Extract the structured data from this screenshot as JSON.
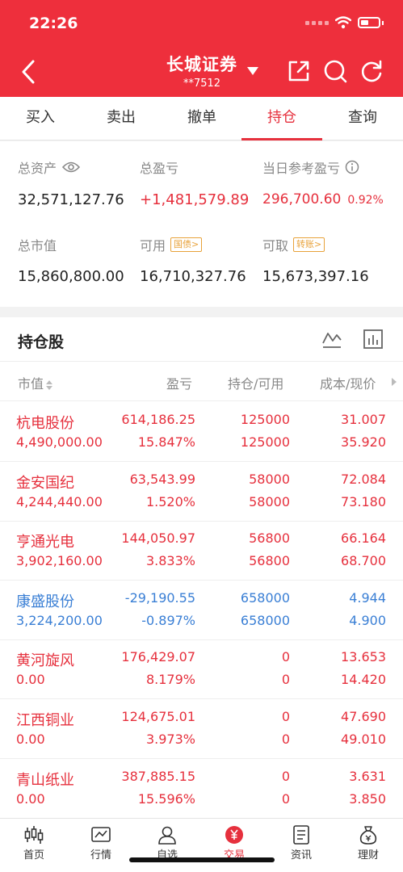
{
  "status": {
    "time": "22:26"
  },
  "header": {
    "title": "长城证券",
    "account": "**7512"
  },
  "tabs": [
    "买入",
    "卖出",
    "撤单",
    "持仓",
    "查询"
  ],
  "summary": {
    "total_assets_label": "总资产",
    "total_assets": "32,571,127.76",
    "total_pl_label": "总盈亏",
    "total_pl": "+1,481,579.89",
    "daily_pl_label": "当日参考盈亏",
    "daily_pl": "296,700.60",
    "daily_pl_pct": "0.92%",
    "market_value_label": "总市值",
    "market_value": "15,860,800.00",
    "available_label": "可用",
    "available_tag": "国债>",
    "available": "16,710,327.76",
    "withdrawable_label": "可取",
    "withdrawable_tag": "转账>",
    "withdrawable": "15,673,397.16"
  },
  "holdings": {
    "title": "持仓股",
    "columns": [
      "市值",
      "盈亏",
      "持仓/可用",
      "成本/现价"
    ],
    "rows": [
      {
        "name": "杭电股份",
        "mv": "4,490,000.00",
        "pl": "614,186.25",
        "pl_pct": "15.847%",
        "pos": "125000",
        "avail": "125000",
        "cost": "31.007",
        "price": "35.920",
        "color": "red"
      },
      {
        "name": "金安国纪",
        "mv": "4,244,440.00",
        "pl": "63,543.99",
        "pl_pct": "1.520%",
        "pos": "58000",
        "avail": "58000",
        "cost": "72.084",
        "price": "73.180",
        "color": "red"
      },
      {
        "name": "亨通光电",
        "mv": "3,902,160.00",
        "pl": "144,050.97",
        "pl_pct": "3.833%",
        "pos": "56800",
        "avail": "56800",
        "cost": "66.164",
        "price": "68.700",
        "color": "red"
      },
      {
        "name": "康盛股份",
        "mv": "3,224,200.00",
        "pl": "-29,190.55",
        "pl_pct": "-0.897%",
        "pos": "658000",
        "avail": "658000",
        "cost": "4.944",
        "price": "4.900",
        "color": "blue"
      },
      {
        "name": "黄河旋风",
        "mv": "0.00",
        "pl": "176,429.07",
        "pl_pct": "8.179%",
        "pos": "0",
        "avail": "0",
        "cost": "13.653",
        "price": "14.420",
        "color": "red"
      },
      {
        "name": "江西铜业",
        "mv": "0.00",
        "pl": "124,675.01",
        "pl_pct": "3.973%",
        "pos": "0",
        "avail": "0",
        "cost": "47.690",
        "price": "49.010",
        "color": "red"
      },
      {
        "name": "青山纸业",
        "mv": "0.00",
        "pl": "387,885.15",
        "pl_pct": "15.596%",
        "pos": "0",
        "avail": "0",
        "cost": "3.631",
        "price": "3.850",
        "color": "red"
      }
    ]
  },
  "nav": [
    "首页",
    "行情",
    "自选",
    "交易",
    "资讯",
    "理财"
  ],
  "colors": {
    "brand_red": "#ee2f3c",
    "up": "#e6303d",
    "down": "#3a7fd5",
    "tag": "#e8a23a"
  }
}
